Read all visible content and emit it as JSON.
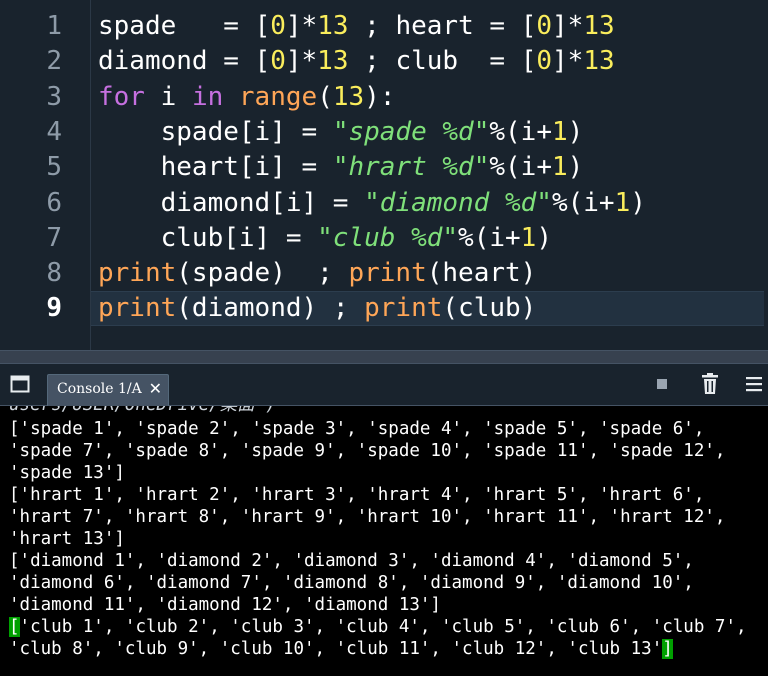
{
  "editor": {
    "lines": [
      {
        "num": "1",
        "current": false,
        "tokens": [
          {
            "t": "spade",
            "c": "id"
          },
          {
            "t": "   = ",
            "c": "op"
          },
          {
            "t": "[",
            "c": "op"
          },
          {
            "t": "0",
            "c": "num"
          },
          {
            "t": "]*",
            "c": "op"
          },
          {
            "t": "13",
            "c": "num"
          },
          {
            "t": " ; ",
            "c": "op"
          },
          {
            "t": "heart",
            "c": "id"
          },
          {
            "t": " = ",
            "c": "op"
          },
          {
            "t": "[",
            "c": "op"
          },
          {
            "t": "0",
            "c": "num"
          },
          {
            "t": "]*",
            "c": "op"
          },
          {
            "t": "13",
            "c": "num"
          }
        ]
      },
      {
        "num": "2",
        "current": false,
        "tokens": [
          {
            "t": "diamond",
            "c": "id"
          },
          {
            "t": " = ",
            "c": "op"
          },
          {
            "t": "[",
            "c": "op"
          },
          {
            "t": "0",
            "c": "num"
          },
          {
            "t": "]*",
            "c": "op"
          },
          {
            "t": "13",
            "c": "num"
          },
          {
            "t": " ; ",
            "c": "op"
          },
          {
            "t": "club",
            "c": "id"
          },
          {
            "t": "  = ",
            "c": "op"
          },
          {
            "t": "[",
            "c": "op"
          },
          {
            "t": "0",
            "c": "num"
          },
          {
            "t": "]*",
            "c": "op"
          },
          {
            "t": "13",
            "c": "num"
          }
        ]
      },
      {
        "num": "3",
        "current": false,
        "tokens": [
          {
            "t": "for",
            "c": "kw"
          },
          {
            "t": " i ",
            "c": "id"
          },
          {
            "t": "in",
            "c": "kw"
          },
          {
            "t": " ",
            "c": "op"
          },
          {
            "t": "range",
            "c": "bi"
          },
          {
            "t": "(",
            "c": "op"
          },
          {
            "t": "13",
            "c": "num"
          },
          {
            "t": "):",
            "c": "op"
          }
        ]
      },
      {
        "num": "4",
        "current": false,
        "tokens": [
          {
            "t": "    spade[i] = ",
            "c": "id"
          },
          {
            "t": "\"spade %d\"",
            "c": "str"
          },
          {
            "t": "%(i+",
            "c": "op"
          },
          {
            "t": "1",
            "c": "num"
          },
          {
            "t": ")",
            "c": "op"
          }
        ]
      },
      {
        "num": "5",
        "current": false,
        "tokens": [
          {
            "t": "    heart[i] = ",
            "c": "id"
          },
          {
            "t": "\"hrart %d\"",
            "c": "str"
          },
          {
            "t": "%(i+",
            "c": "op"
          },
          {
            "t": "1",
            "c": "num"
          },
          {
            "t": ")",
            "c": "op"
          }
        ]
      },
      {
        "num": "6",
        "current": false,
        "tokens": [
          {
            "t": "    diamond[i] = ",
            "c": "id"
          },
          {
            "t": "\"diamond %d\"",
            "c": "str"
          },
          {
            "t": "%(i+",
            "c": "op"
          },
          {
            "t": "1",
            "c": "num"
          },
          {
            "t": ")",
            "c": "op"
          }
        ]
      },
      {
        "num": "7",
        "current": false,
        "tokens": [
          {
            "t": "    club[i] = ",
            "c": "id"
          },
          {
            "t": "\"club %d\"",
            "c": "str"
          },
          {
            "t": "%(i+",
            "c": "op"
          },
          {
            "t": "1",
            "c": "num"
          },
          {
            "t": ")",
            "c": "op"
          }
        ]
      },
      {
        "num": "8",
        "current": false,
        "tokens": [
          {
            "t": "print",
            "c": "bi"
          },
          {
            "t": "(spade)  ; ",
            "c": "op"
          },
          {
            "t": "print",
            "c": "bi"
          },
          {
            "t": "(heart)",
            "c": "op"
          }
        ]
      },
      {
        "num": "9",
        "current": true,
        "tokens": [
          {
            "t": "print",
            "c": "bi"
          },
          {
            "t": "(diamond) ; ",
            "c": "op"
          },
          {
            "t": "print",
            "c": "bi"
          },
          {
            "t": "(club)",
            "c": "op"
          }
        ]
      }
    ]
  },
  "console_pane": {
    "tab_label": "Console 1/A",
    "close_glyph": "✕",
    "icons": [
      "pane-icon",
      "stop-icon",
      "trash-icon",
      "menu-icon"
    ]
  },
  "console": {
    "cut_line": "users/USER/OneDrive/桌面')",
    "lines": [
      "['spade 1', 'spade 2', 'spade 3', 'spade 4', 'spade 5', 'spade 6',",
      "'spade 7', 'spade 8', 'spade 9', 'spade 10', 'spade 11', 'spade 12',",
      "'spade 13']",
      "['hrart 1', 'hrart 2', 'hrart 3', 'hrart 4', 'hrart 5', 'hrart 6',",
      "'hrart 7', 'hrart 8', 'hrart 9', 'hrart 10', 'hrart 11', 'hrart 12',",
      "'hrart 13']",
      "['diamond 1', 'diamond 2', 'diamond 3', 'diamond 4', 'diamond 5',",
      "'diamond 6', 'diamond 7', 'diamond 8', 'diamond 9', 'diamond 10',",
      "'diamond 11', 'diamond 12', 'diamond 13']"
    ],
    "club_first": "'club 1', 'club 2', 'club 3', 'club 4', 'club 5', 'club 6', 'club 7',",
    "club_second": "'club 8', 'club 9', 'club 10', 'club 11', 'club 12', 'club 13'",
    "open_bracket": "[",
    "close_bracket": "]"
  }
}
